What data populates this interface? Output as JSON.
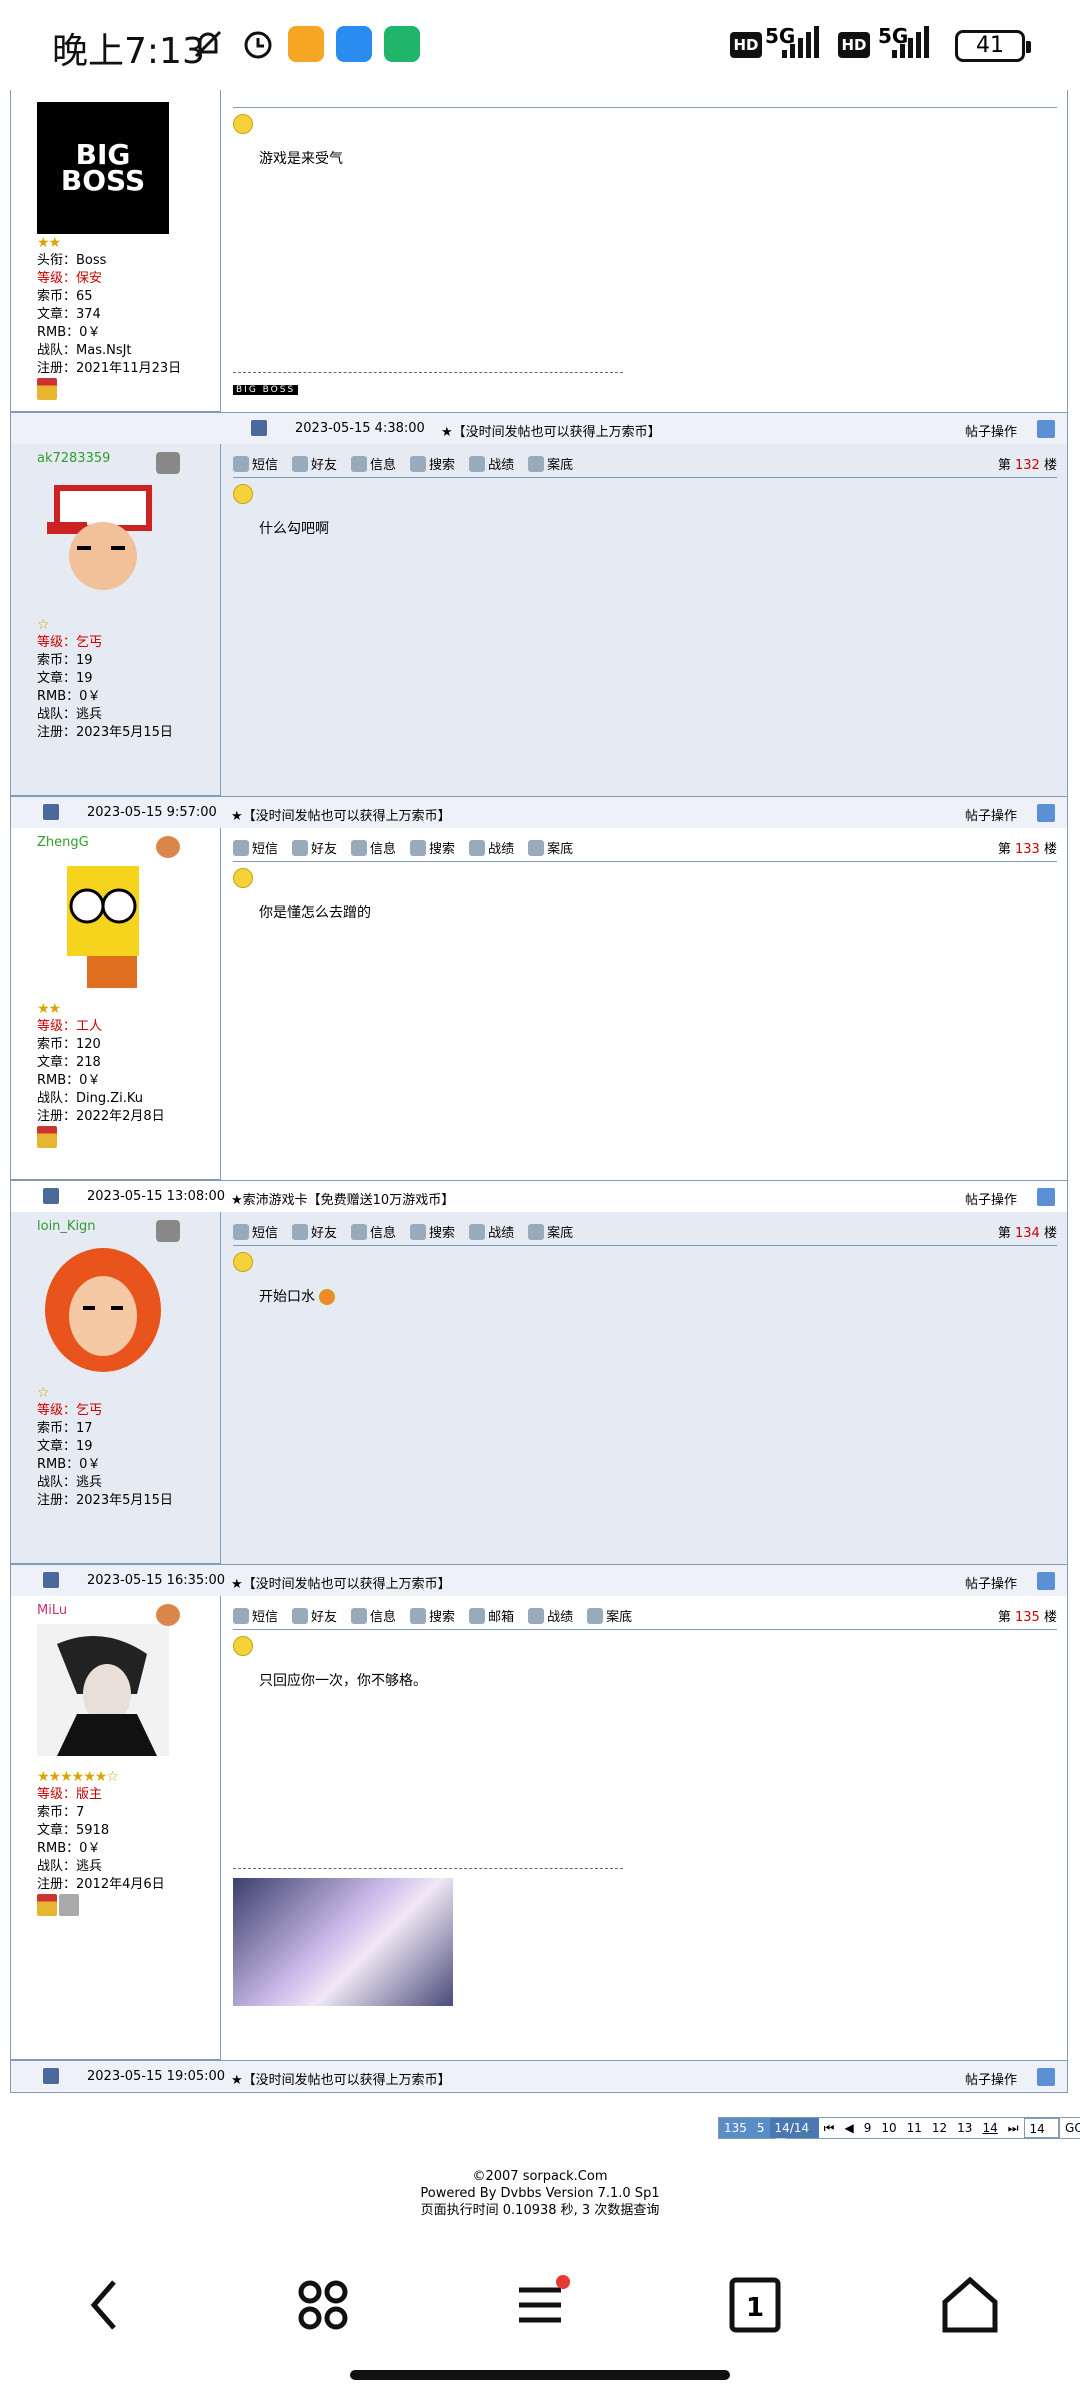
{
  "status": {
    "time": "晚上7:13",
    "net1": "5G",
    "net2": "5G",
    "battery": "41"
  },
  "toolbar": {
    "msg": "短信",
    "friend": "好友",
    "info": "信息",
    "search": "搜索",
    "record": "战绩",
    "case": "案底",
    "mail": "邮箱"
  },
  "post_ops": "帖子操作",
  "floor_prefix": "第",
  "floor_suffix": "楼",
  "labels": {
    "level": "等级：",
    "coins": "索币：",
    "articles": "文章：",
    "rmb": "RMB：",
    "team": "战队：",
    "reg": "注册：",
    "title": "头衔："
  },
  "top_post": {
    "title": "Boss",
    "level": "保安",
    "coins": "65",
    "articles": "374",
    "rmb": "0￥",
    "team": "Mas.NsJt",
    "reg": "2021年11月23日",
    "content": "游戏是来受气",
    "footer_time": "2023-05-15 4:38:00",
    "footer_ad": "★【没时间发帖也可以获得上万索币】",
    "sig_text": "BIG BOSS"
  },
  "posts": [
    {
      "user": "ak7283359",
      "level": "乞丐",
      "coins": "19",
      "articles": "19",
      "rmb": "0￥",
      "team": "逃兵",
      "reg": "2023年5月15日",
      "floor": "132",
      "content": "什么勾吧啊",
      "footer_time": "2023-05-15 9:57:00",
      "footer_ad": "★【没时间发帖也可以获得上万索币】"
    },
    {
      "user": "ZhengG",
      "level": "工人",
      "coins": "120",
      "articles": "218",
      "rmb": "0￥",
      "team": "Ding.Zi.Ku",
      "reg": "2022年2月8日",
      "floor": "133",
      "content": "你是懂怎么去蹭的",
      "footer_time": "2023-05-15 13:08:00",
      "footer_ad": "★索沛游戏卡【免费赠送10万游戏币】"
    },
    {
      "user": "loin_Kign",
      "level": "乞丐",
      "coins": "17",
      "articles": "19",
      "rmb": "0￥",
      "team": "逃兵",
      "reg": "2023年5月15日",
      "floor": "134",
      "content": "开始口水",
      "footer_time": "2023-05-15 16:35:00",
      "footer_ad": "★【没时间发帖也可以获得上万索币】"
    },
    {
      "user": "MiLu",
      "level": "版主",
      "coins": "7",
      "articles": "5918",
      "rmb": "0￥",
      "team": "逃兵",
      "reg": "2012年4月6日",
      "floor": "135",
      "content": "只回应你一次，你不够格。",
      "footer_time": "2023-05-15 19:05:00",
      "footer_ad": "★【没时间发帖也可以获得上万索币】"
    }
  ],
  "pager": {
    "total": "135",
    "per": "5",
    "pages": "14/14页",
    "nums": [
      "9",
      "10",
      "11",
      "12",
      "13",
      "14"
    ],
    "current": "14",
    "input": "14",
    "go": "GO"
  },
  "footer": {
    "copy": "©2007 sorpack.Com",
    "powered": "Powered By Dvbbs Version 7.1.0 Sp1",
    "exec": "页面执行时间 0.10938 秒, 3 次数据查询"
  }
}
